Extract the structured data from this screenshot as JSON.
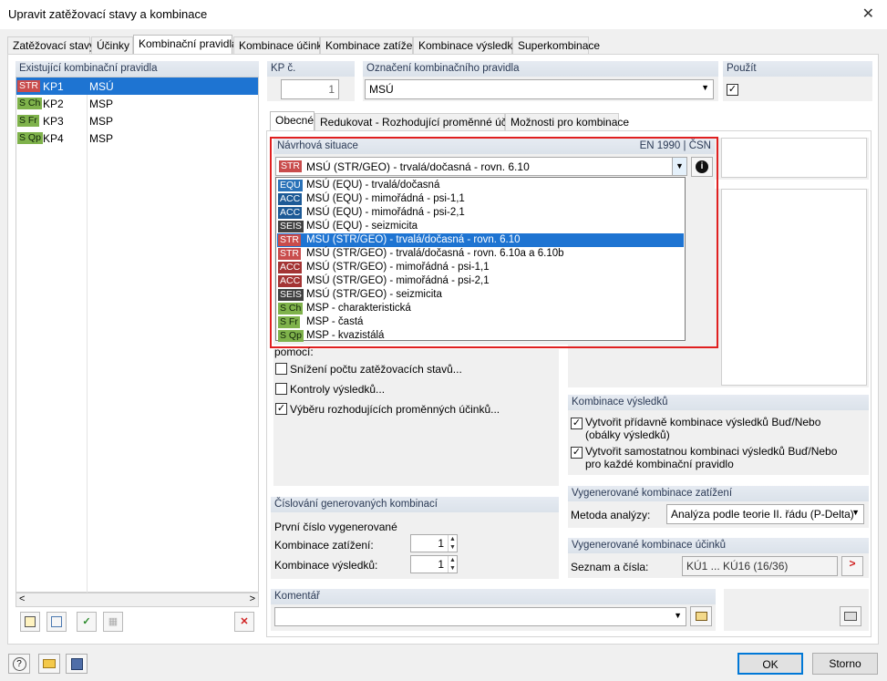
{
  "window": {
    "title": "Upravit zatěžovací stavy a kombinace",
    "close": "✕"
  },
  "tabs": [
    "Zatěžovací stavy",
    "Účinky",
    "Kombinační pravidla",
    "Kombinace účinků",
    "Kombinace zatížení",
    "Kombinace výsledků",
    "Superkombinace"
  ],
  "left": {
    "header": "Existující kombinační pravidla",
    "rows": [
      {
        "badge": "STR",
        "code": "KP1",
        "name": "MSÚ",
        "color": "#c94c4c"
      },
      {
        "badge": "S Ch",
        "code": "KP2",
        "name": "MSP",
        "color": "#7fb24b"
      },
      {
        "badge": "S Fr",
        "code": "KP3",
        "name": "MSP",
        "color": "#7fb24b"
      },
      {
        "badge": "S Qp",
        "code": "KP4",
        "name": "MSP",
        "color": "#7fb24b"
      }
    ],
    "scroll_left": "<",
    "scroll_right": ">"
  },
  "kp": {
    "label": "KP č.",
    "value": "1"
  },
  "oznaceni": {
    "label": "Označení kombinačního pravidla",
    "value": "MSÚ"
  },
  "pouzit": {
    "label": "Použít",
    "check": "✓"
  },
  "subtabs": [
    "Obecné",
    "Redukovat - Rozhodující proměnné účinky",
    "Možnosti pro kombinace"
  ],
  "navrhova": {
    "label": "Návrhová situace",
    "standard": "EN 1990 | ČSN",
    "selected_badge": "STR",
    "selected": "MSÚ (STR/GEO) - trvalá/dočasná - rovn. 6.10",
    "info": "i",
    "options": [
      {
        "badge": "EQU",
        "text": "MSÚ (EQU) - trvalá/dočasná"
      },
      {
        "badge": "ACC",
        "text": "MSÚ (EQU) - mimořádná - psi-1,1"
      },
      {
        "badge": "ACC",
        "text": "MSÚ (EQU) - mimořádná - psi-2,1"
      },
      {
        "badge": "SEIS",
        "text": "MSÚ (EQU) - seizmicita"
      },
      {
        "badge": "STR",
        "text": "MSÚ (STR/GEO) - trvalá/dočasná - rovn. 6.10"
      },
      {
        "badge": "STR",
        "text": "MSÚ (STR/GEO) - trvalá/dočasná - rovn. 6.10a a 6.10b"
      },
      {
        "badge": "ACC",
        "text": "MSÚ (STR/GEO) - mimořádná - psi-1,1"
      },
      {
        "badge": "ACC",
        "text": "MSÚ (STR/GEO) - mimořádná - psi-2,1"
      },
      {
        "badge": "SEIS",
        "text": "MSÚ (STR/GEO) - seizmicita"
      },
      {
        "badge": "S Ch",
        "text": "MSP - charakteristická"
      },
      {
        "badge": "S Fr",
        "text": "MSP - častá"
      },
      {
        "badge": "S Qp",
        "text": "MSP - kvazistálá"
      }
    ]
  },
  "options": {
    "pomoci": "pomocí:",
    "snizeni": "Snížení počtu zatěžovacích stavů...",
    "kontroly": "Kontroly výsledků...",
    "vyberu": "Výběru rozhodujících proměnných účinků...",
    "check": "✓"
  },
  "cislovani": {
    "header": "Číslování generovaných kombinací",
    "first": "První číslo vygenerované",
    "kz_label": "Kombinace zatížení:",
    "kz_value": "1",
    "kv_label": "Kombinace výsledků:",
    "kv_value": "1"
  },
  "kombinace_vysledku": {
    "header": "Kombinace výsledků",
    "opt1_a": "Vytvořit přídavně kombinace výsledků Buď/Nebo",
    "opt1_b": "(obálky výsledků)",
    "opt2_a": "Vytvořit samostatnou kombinaci výsledků Buď/Nebo",
    "opt2_b": "pro každé kombinační pravidlo"
  },
  "vygen_kz": {
    "header": "Vygenerované kombinace zatížení",
    "label": "Metoda analýzy:",
    "value": "Analýza podle teorie II. řádu (P-Delta)"
  },
  "vygen_ku": {
    "header": "Vygenerované kombinace účinků",
    "label": "Seznam a čísla:",
    "value": "KÚ1 ... KÚ16 (16/36)",
    "go": ">"
  },
  "komentar": {
    "header": "Komentář"
  },
  "footer": {
    "ok": "OK",
    "cancel": "Storno"
  }
}
